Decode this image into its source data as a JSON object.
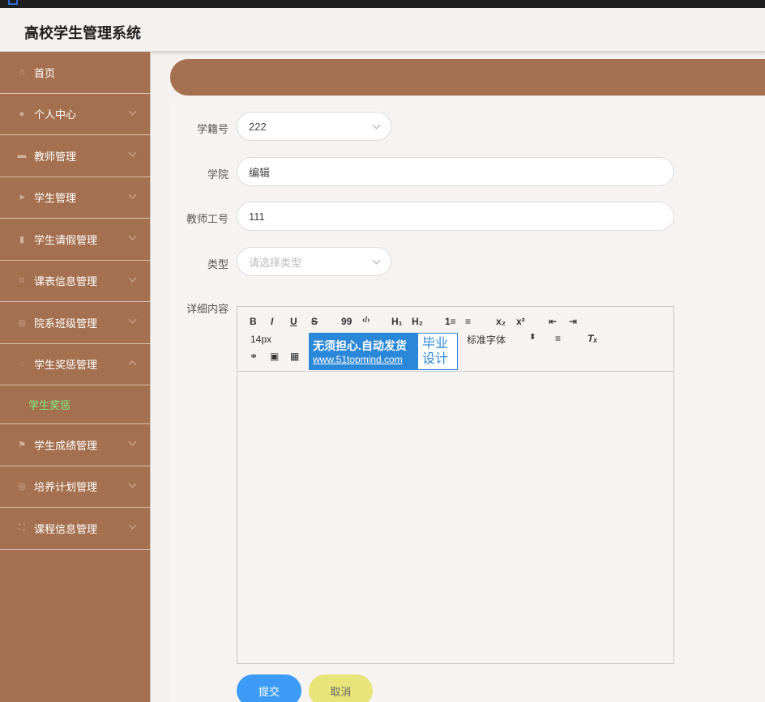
{
  "app": {
    "title": "高校学生管理系统"
  },
  "sidebar": {
    "items": [
      {
        "label": "首页",
        "icon": "home-icon",
        "glyph": "⌂",
        "arrow": "none"
      },
      {
        "label": "个人中心",
        "icon": "user-icon",
        "glyph": "●",
        "arrow": "down"
      },
      {
        "label": "教师管理",
        "icon": "briefcase-icon",
        "glyph": "▬",
        "arrow": "down"
      },
      {
        "label": "学生管理",
        "icon": "send-icon",
        "glyph": "➤",
        "arrow": "down"
      },
      {
        "label": "学生请假管理",
        "icon": "books-icon",
        "glyph": "▮",
        "arrow": "down"
      },
      {
        "label": "课表信息管理",
        "icon": "crop-icon",
        "glyph": "⌑",
        "arrow": "down"
      },
      {
        "label": "院系班级管理",
        "icon": "globe-icon",
        "glyph": "◎",
        "arrow": "down"
      },
      {
        "label": "学生奖惩管理",
        "icon": "power-icon",
        "glyph": "◌",
        "arrow": "up"
      },
      {
        "label": "学生成绩管理",
        "icon": "flag-icon",
        "glyph": "⚑",
        "arrow": "down"
      },
      {
        "label": "培养计划管理",
        "icon": "support-icon",
        "glyph": "◎",
        "arrow": "down"
      },
      {
        "label": "课程信息管理",
        "icon": "fullscreen-icon",
        "glyph": "⛶",
        "arrow": "down"
      }
    ],
    "submenu": {
      "label": "学生奖惩"
    }
  },
  "form": {
    "student_id": {
      "label": "学籍号",
      "value": "222"
    },
    "college": {
      "label": "学院",
      "value": "编辑"
    },
    "teacher_id": {
      "label": "教师工号",
      "value": "111"
    },
    "type": {
      "label": "类型",
      "placeholder": "请选择类型"
    },
    "detail": {
      "label": "详细内容"
    }
  },
  "editor": {
    "font_size": "14px",
    "font_family": "标准字体",
    "toolbar": {
      "bold": "B",
      "italic": "I",
      "underline": "U",
      "strike": "S",
      "quote": "99",
      "code": "‹/›",
      "h1": "H₁",
      "h2": "H₂",
      "ordered": "1≡",
      "bullet": "≡",
      "sub": "x₂",
      "sup": "x²",
      "outdent": "⇤",
      "indent": "⇥",
      "align": "≡",
      "clean": "Tₓ",
      "link": "⚭",
      "image": "▣",
      "video": "▦"
    }
  },
  "watermark": {
    "line1": "无须担心.自动发货",
    "line2": "www.51topmind.com",
    "right1": "毕业",
    "right2": "设计"
  },
  "buttons": {
    "submit": "提交",
    "cancel": "取消"
  },
  "colors": {
    "sidebar": "#a4704f",
    "submit": "#3c9cf5",
    "cancel": "#e8e47a",
    "active_submenu": "#7ef07e"
  }
}
